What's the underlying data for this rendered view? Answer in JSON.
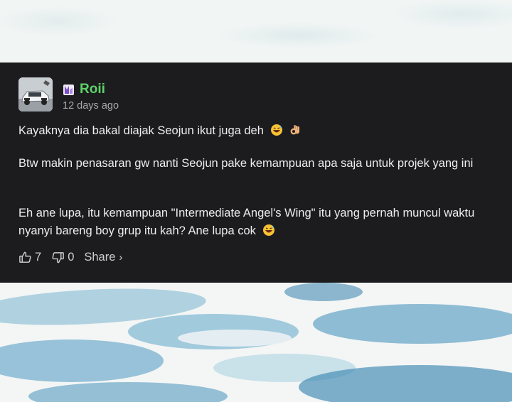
{
  "comment": {
    "username": "Roii",
    "timestamp": "12 days ago",
    "paragraphs": {
      "p1": "Kayaknya dia bakal diajak Seojun ikut juga deh",
      "p2": "Btw makin penasaran gw nanti Seojun pake kemampuan apa saja untuk projek yang ini",
      "p3": "Eh ane lupa, itu kemampuan \"Intermediate Angel's Wing\" itu yang pernah muncul waktu nyanyi bareng boy grup itu kah? Ane lupa cok"
    },
    "likes": "7",
    "dislikes": "0",
    "share_label": "Share",
    "share_chevron": "›",
    "icons": {
      "like": "thumbs-up-icon",
      "dislike": "thumbs-down-icon",
      "badge": "rank-badge-icon",
      "emoji_laugh": "grinning-sweat-emoji",
      "emoji_ok": "ok-hand-emoji"
    },
    "colors": {
      "card_bg": "#1c1c1f",
      "username": "#5fd16a",
      "text": "#eeeeef",
      "muted": "#a8a8ac"
    }
  }
}
